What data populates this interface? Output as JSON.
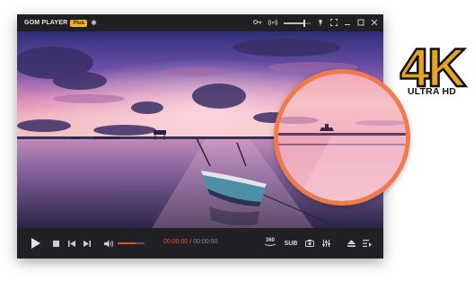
{
  "app": {
    "title": "GOM PLAYER",
    "badge": "Plus"
  },
  "titlebar": {
    "volume_level": 0.75
  },
  "controls": {
    "current_time": "00:00:00",
    "separator": " / ",
    "total_time": "00:00:00",
    "volume_level": 0.65,
    "vr360_label": "360",
    "subtitle_label": "SUB"
  },
  "promo": {
    "resolution_label": "4K",
    "ultra_hd_label": "ULTRA HD"
  },
  "colors": {
    "accent": "#e8502d",
    "badge": "#f2b428",
    "ring": "#f07a4a"
  }
}
